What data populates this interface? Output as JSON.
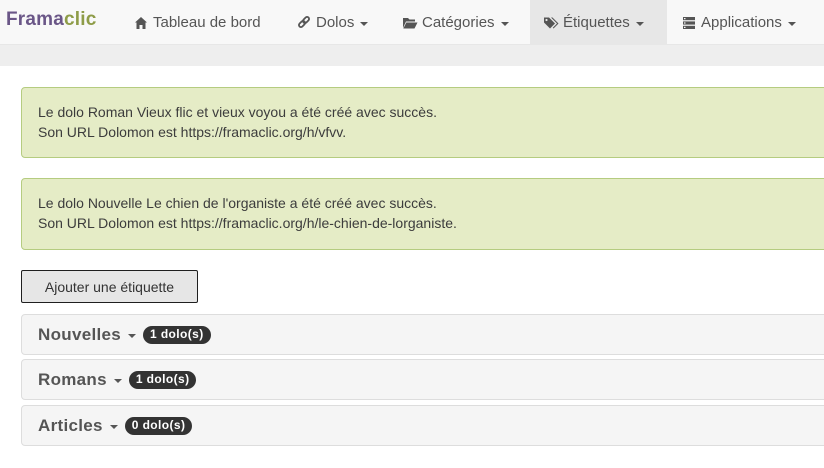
{
  "navbar": {
    "brand_part1": "Frama",
    "brand_part2": "clic",
    "items": [
      {
        "label": "Tableau de bord",
        "icon": "home-icon",
        "caret": false,
        "active": false
      },
      {
        "label": "Dolos",
        "icon": "link-icon",
        "caret": true,
        "active": false
      },
      {
        "label": "Catégories",
        "icon": "folder-open-icon",
        "caret": true,
        "active": false
      },
      {
        "label": "Étiquettes",
        "icon": "tags-icon",
        "caret": true,
        "active": true
      },
      {
        "label": "Applications",
        "icon": "server-icon",
        "caret": true,
        "active": false
      }
    ]
  },
  "alerts": [
    {
      "line1": "Le dolo Roman Vieux flic et vieux voyou a été créé avec succès.",
      "line2": "Son URL Dolomon est https://framaclic.org/h/vfvv."
    },
    {
      "line1": "Le dolo Nouvelle Le chien de l'organiste a été créé avec succès.",
      "line2": "Son URL Dolomon est https://framaclic.org/h/le-chien-de-lorganiste."
    }
  ],
  "add_button_label": "Ajouter une étiquette",
  "tags": [
    {
      "name": "Nouvelles",
      "badge": "1 dolo(s)"
    },
    {
      "name": "Romans",
      "badge": "1 dolo(s)"
    },
    {
      "name": "Articles",
      "badge": "0 dolo(s)"
    }
  ],
  "colors": {
    "brand_purple": "#6a5687",
    "brand_green": "#8e9c48",
    "alert_bg": "#e5ecc6",
    "badge_bg": "#333333"
  }
}
